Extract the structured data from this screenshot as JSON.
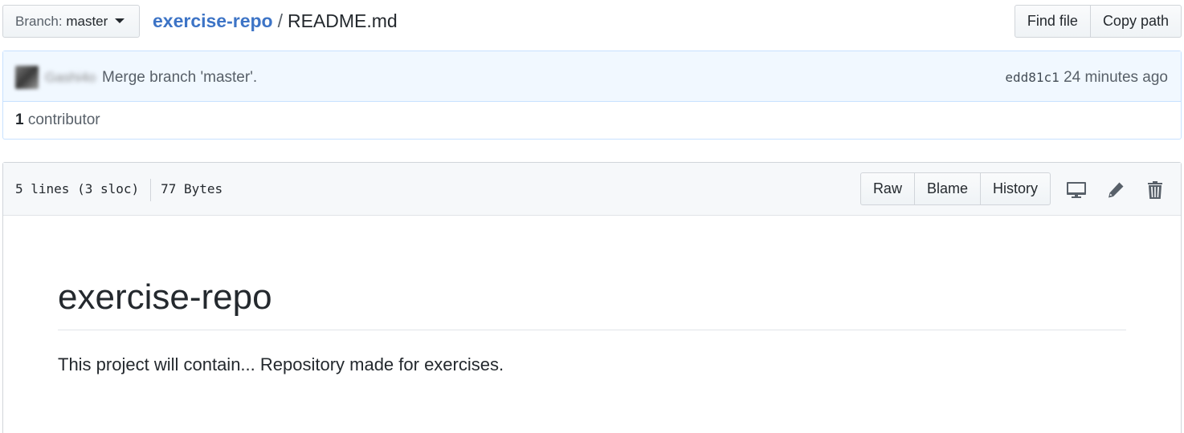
{
  "topbar": {
    "branch_label": "Branch:",
    "branch_value": "master",
    "repo_name": "exercise-repo",
    "separator": "/",
    "file_name": "README.md",
    "find_file_label": "Find file",
    "copy_path_label": "Copy path"
  },
  "commit": {
    "author": "Gashi4o",
    "message": "Merge branch 'master'.",
    "sha": "edd81c1",
    "time": "24 minutes ago"
  },
  "contributors": {
    "count": "1",
    "label": "contributor"
  },
  "file": {
    "lines": "5 lines (3 sloc)",
    "size": "77 Bytes",
    "raw_label": "Raw",
    "blame_label": "Blame",
    "history_label": "History",
    "icons": [
      "desktop-icon",
      "pencil-icon",
      "trash-icon"
    ]
  },
  "readme": {
    "heading": "exercise-repo",
    "paragraph": "This project will contain... Repository made for exercises."
  },
  "colors": {
    "link": "#3d74c6",
    "commit_bg": "#f1f8ff",
    "commit_border": "#c8e1ff",
    "header_bg": "#f6f8fa"
  }
}
